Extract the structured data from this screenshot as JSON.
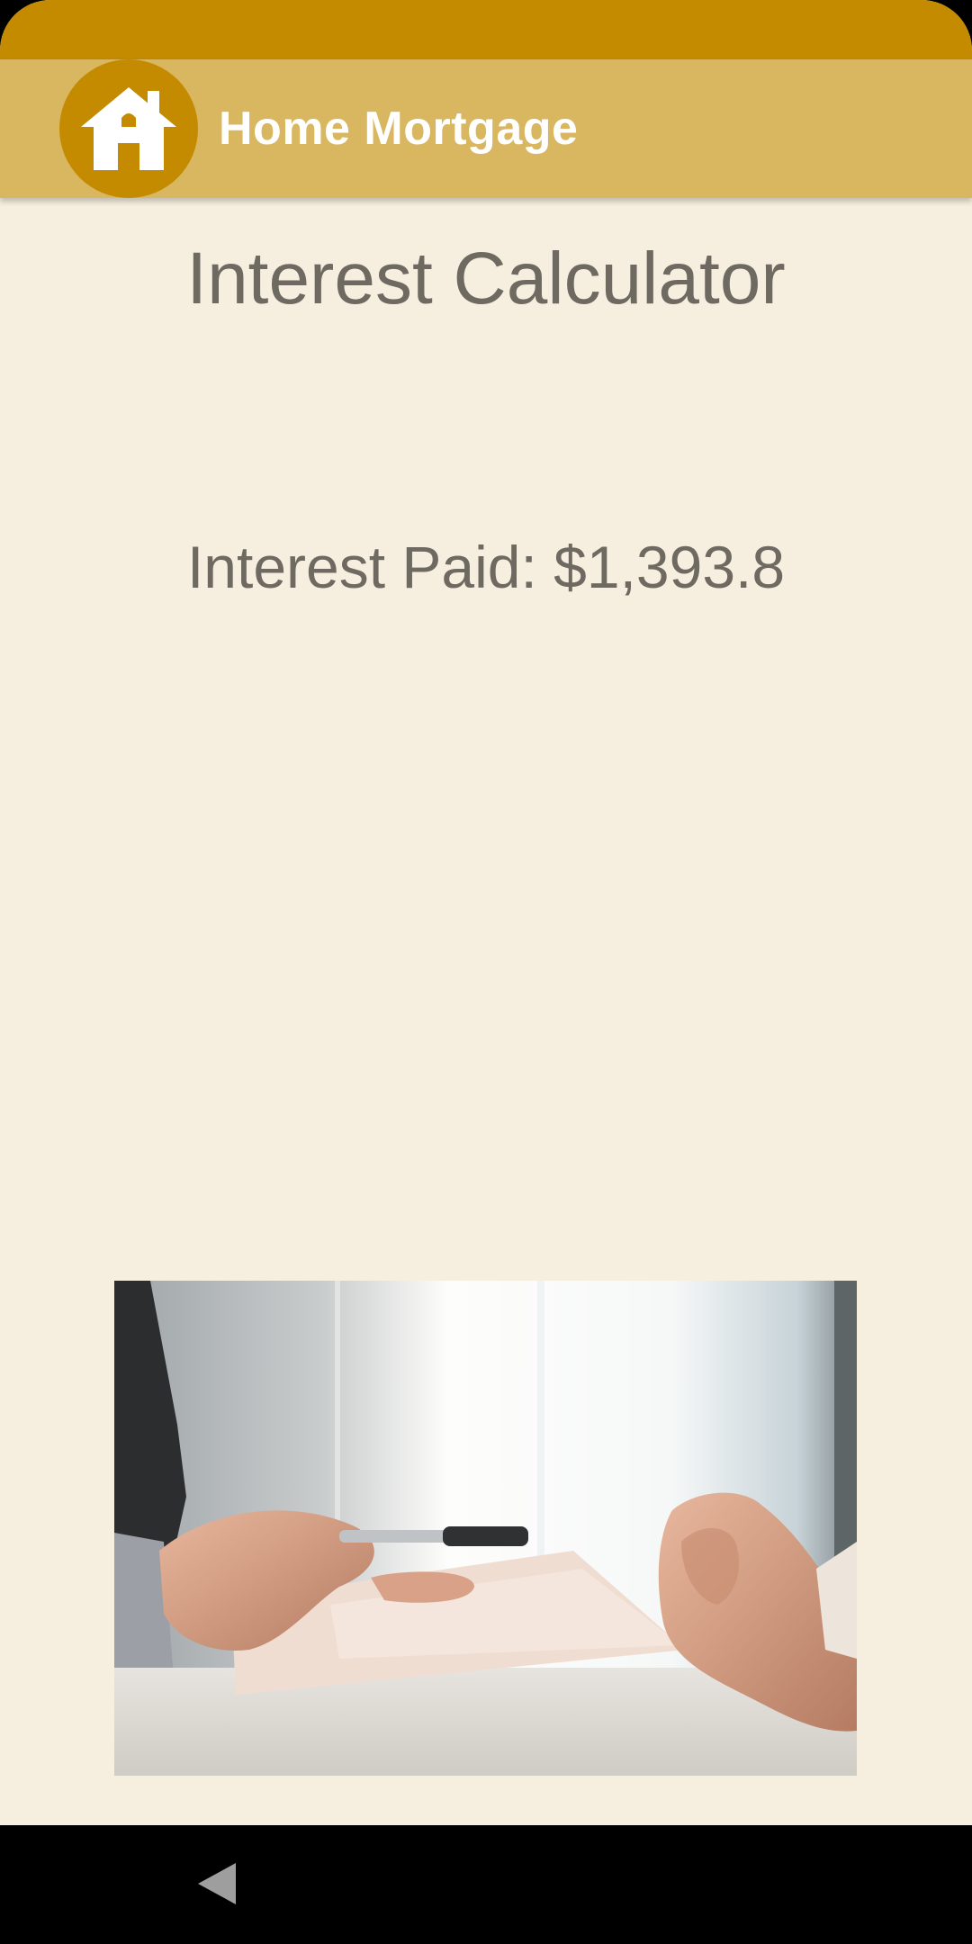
{
  "app_bar": {
    "title": "Home Mortgage",
    "logo_icon": "house-icon"
  },
  "main": {
    "title": "Interest Calculator",
    "result": "Interest Paid: $1,393.8"
  },
  "photo": {
    "subject": "contract-signing-photo"
  },
  "nav_bar": {
    "back_icon": "back-triangle-icon"
  },
  "colors": {
    "status_bar": "#C48A00",
    "app_bar": "#D9B660",
    "background": "#F6EFDF",
    "text": "#6E6A62",
    "logo_circle": "#C48A00"
  }
}
